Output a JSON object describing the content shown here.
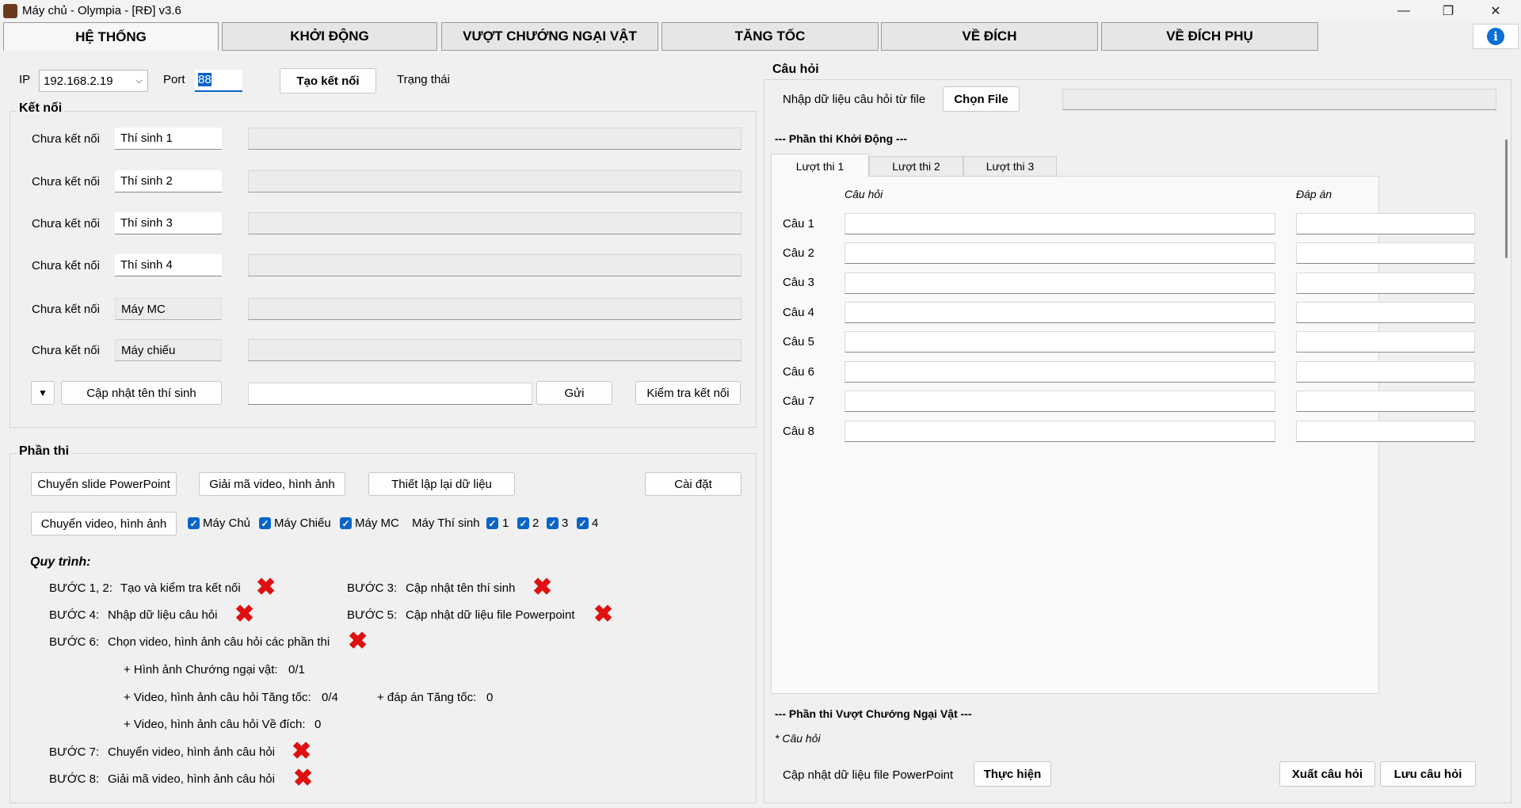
{
  "window": {
    "title": "Máy chủ - Olympia - [RĐ] v3.6",
    "minimize": "—",
    "maximize": "❐",
    "close": "✕"
  },
  "tabs": [
    "HỆ THỐNG",
    "KHỞI ĐỘNG",
    "VƯỢT CHƯỚNG NGẠI VẬT",
    "TĂNG TỐC",
    "VỀ ĐÍCH",
    "VỀ ĐÍCH PHỤ"
  ],
  "info_icon": "info-icon",
  "connection": {
    "ip_label": "IP",
    "ip_value": "192.168.2.19",
    "port_label": "Port",
    "port_value": "88",
    "connect_button": "Tạo kết nối",
    "status_label": "Trạng thái"
  },
  "ketnoi": {
    "title": "Kết nối",
    "rows": [
      {
        "status": "Chưa kết nối",
        "name": "Thí sinh 1",
        "message": ""
      },
      {
        "status": "Chưa kết nối",
        "name": "Thí sinh 2",
        "message": ""
      },
      {
        "status": "Chưa kết nối",
        "name": "Thí sinh 3",
        "message": ""
      },
      {
        "status": "Chưa kết nối",
        "name": "Thí sinh 4",
        "message": ""
      },
      {
        "status": "Chưa kết nối",
        "name": "Máy MC",
        "message": ""
      },
      {
        "status": "Chưa kết nối",
        "name": "Máy chiếu",
        "message": ""
      }
    ],
    "dropdown_icon": "caret-down-icon",
    "update_names_button": "Cập nhật tên thí sinh",
    "send_input": "",
    "send_button": "Gửi",
    "check_button": "Kiểm tra kết nối"
  },
  "phanthi": {
    "title": "Phần thi",
    "btn_ppt": "Chuyển slide PowerPoint",
    "btn_decode": "Giải mã video, hình ảnh",
    "btn_reset": "Thiết lập lại dữ liệu",
    "btn_settings": "Cài đặt",
    "btn_transfer": "Chuyển video, hình ảnh",
    "chk_server": "Máy Chủ",
    "chk_projector": "Máy Chiếu",
    "chk_mc": "Máy MC",
    "contestant_label": "Máy Thí sinh",
    "chk_c1": "1",
    "chk_c2": "2",
    "chk_c3": "3",
    "chk_c4": "4",
    "checked": true
  },
  "quytrinh": {
    "title": "Quy trình:",
    "step12": "BƯỚC 1, 2:",
    "step12_text": "Tạo và kiểm tra kết nối",
    "step3": "BƯỚC 3:",
    "step3_text": "Cập nhật tên thí sinh",
    "step4": "BƯỚC 4:",
    "step4_text": "Nhập dữ liệu câu hỏi",
    "step5": "BƯỚC 5:",
    "step5_text": "Cập nhật dữ liệu file Powerpoint",
    "step6": "BƯỚC 6:",
    "step6_text": "Chọn video, hình ảnh câu hỏi các phần thi",
    "sub1_label": "+ Hình ảnh Chướng ngại vật:",
    "sub1_value": "0/1",
    "sub2_label": "+ Video, hình ảnh câu hỏi Tăng tốc:",
    "sub2_value": "0/4",
    "sub3_label": "+ đáp án Tăng tốc:",
    "sub3_value": "0",
    "sub4_label": "+ Video, hình ảnh câu hỏi Về đích:",
    "sub4_value": "0",
    "step7": "BƯỚC 7:",
    "step7_text": "Chuyển video, hình ảnh câu hỏi",
    "step8": "BƯỚC 8:",
    "step8_text": "Giải mã video, hình ảnh câu hỏi",
    "status_mark": "✖"
  },
  "cauhoi": {
    "title": "Câu hỏi",
    "import_label": "Nhập dữ liệu câu hỏi từ file",
    "choose_file": "Chọn File",
    "file_path": "",
    "section_khoidong": "--- Phần thi Khởi Động ---",
    "subtabs": [
      "Lượt thi 1",
      "Lượt thi 2",
      "Lượt thi 3"
    ],
    "col_question": "Câu hỏi",
    "col_answer": "Đáp án",
    "rows": [
      {
        "label": "Câu 1",
        "question": "",
        "answer": ""
      },
      {
        "label": "Câu 2",
        "question": "",
        "answer": ""
      },
      {
        "label": "Câu 3",
        "question": "",
        "answer": ""
      },
      {
        "label": "Câu 4",
        "question": "",
        "answer": ""
      },
      {
        "label": "Câu 5",
        "question": "",
        "answer": ""
      },
      {
        "label": "Câu 6",
        "question": "",
        "answer": ""
      },
      {
        "label": "Câu 7",
        "question": "",
        "answer": ""
      },
      {
        "label": "Câu 8",
        "question": "",
        "answer": ""
      }
    ],
    "section_vcnv": "--- Phần thi Vượt Chướng Ngại Vật ---",
    "vcnv_sub": "* Câu hỏi",
    "ppt_update_label": "Cập nhật dữ liệu file PowerPoint",
    "run_button": "Thực hiện",
    "export_button": "Xuất câu hỏi",
    "save_button": "Lưu câu hỏi"
  }
}
